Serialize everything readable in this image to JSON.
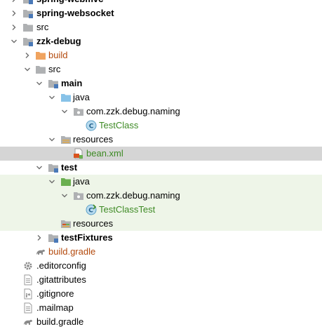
{
  "project_tree": {
    "rows": [
      {
        "label": "spring-webmvc"
      },
      {
        "label": "spring-websocket"
      },
      {
        "label": "src"
      },
      {
        "label": "zzk-debug"
      },
      {
        "label": "build"
      },
      {
        "label": "src"
      },
      {
        "label": "main"
      },
      {
        "label": "java"
      },
      {
        "label": "com.zzk.debug.naming"
      },
      {
        "label": "TestClass"
      },
      {
        "label": "resources"
      },
      {
        "label": "bean.xml"
      },
      {
        "label": "test"
      },
      {
        "label": "java"
      },
      {
        "label": "com.zzk.debug.naming"
      },
      {
        "label": "TestClassTest"
      },
      {
        "label": "resources"
      },
      {
        "label": "testFixtures"
      },
      {
        "label": "build.gradle"
      },
      {
        "label": ".editorconfig"
      },
      {
        "label": ".gitattributes"
      },
      {
        "label": ".gitignore"
      },
      {
        "label": ".mailmap"
      },
      {
        "label": "build.gradle"
      }
    ]
  },
  "colors": {
    "selection": "#d5d5d5",
    "test_scope": "#eef5e8",
    "green_text": "#3d8a24",
    "orange_text": "#b3490c",
    "folder": "#afb1b3",
    "source_folder": "#87c2e8",
    "test_folder": "#6aaf50",
    "build_folder": "#f0a35f"
  }
}
